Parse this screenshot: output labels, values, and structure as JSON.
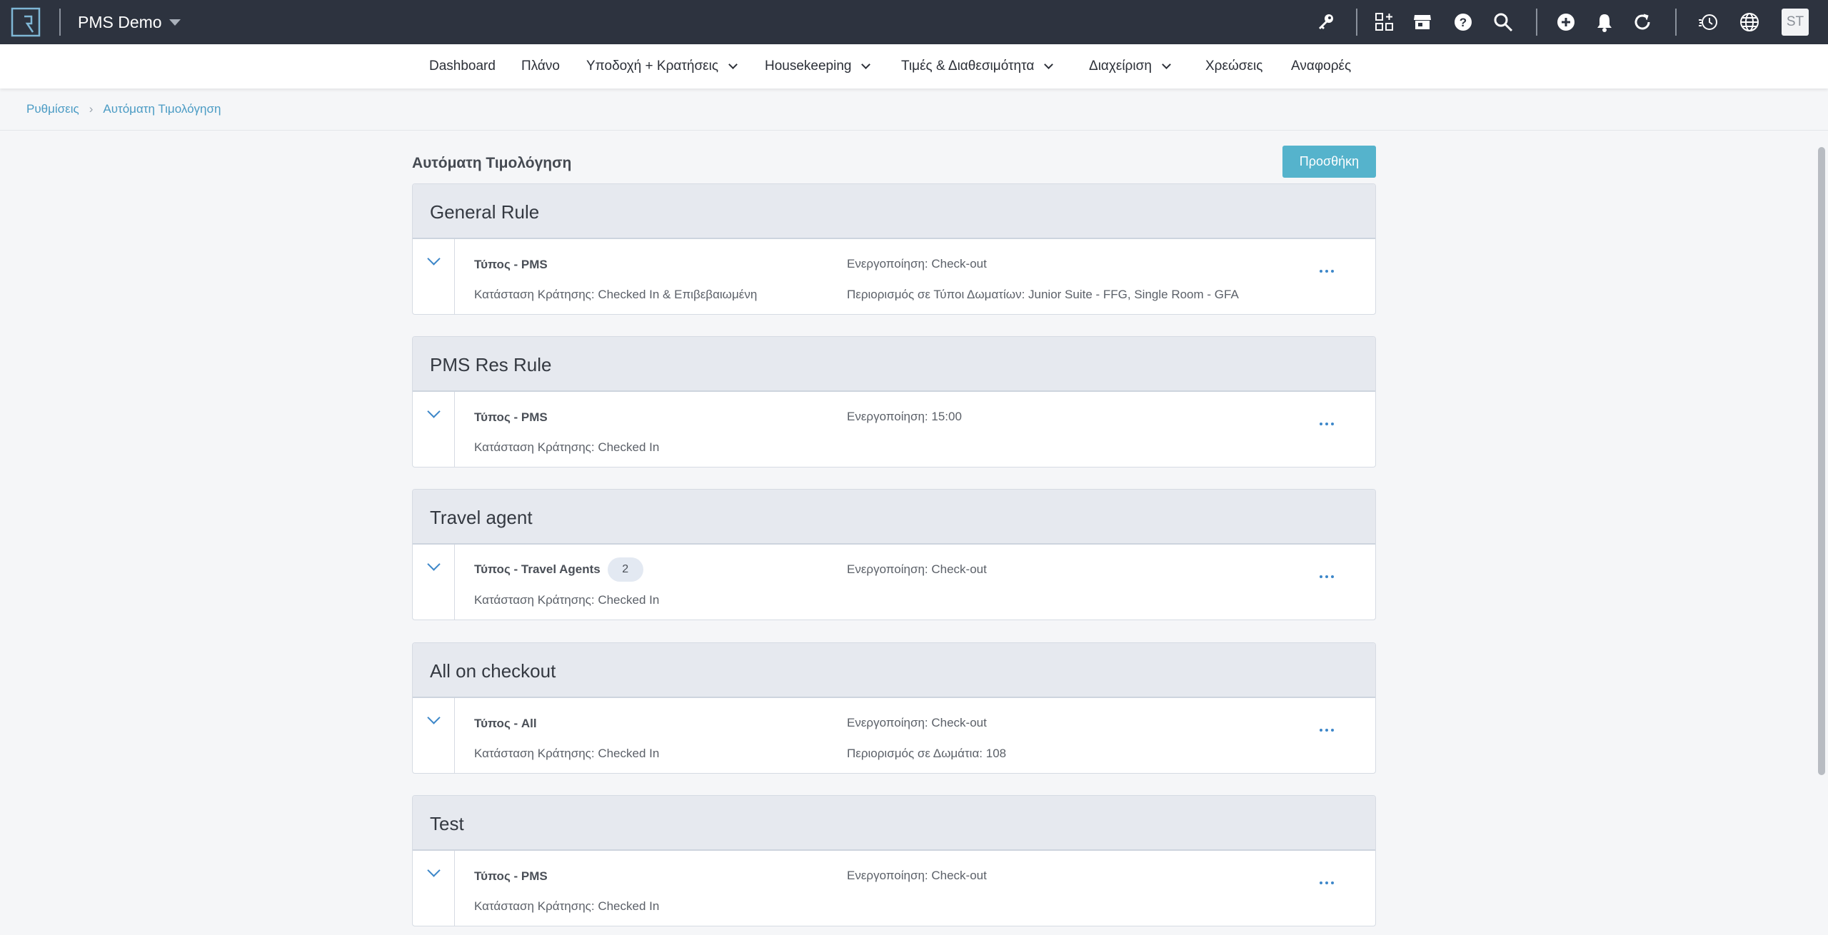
{
  "app": {
    "title": "PMS Demo",
    "avatar_initials": "ST",
    "icons": [
      "key-icon",
      "apps-add-icon",
      "store-icon",
      "help-icon",
      "search-icon",
      "add-circle-icon",
      "bell-icon",
      "refresh-icon",
      "history-clock-icon",
      "globe-icon"
    ]
  },
  "nav": {
    "items": [
      {
        "label": "Dashboard",
        "has_menu": false
      },
      {
        "label": "Πλάνο",
        "has_menu": false
      },
      {
        "label": "Υποδοχή + Κρατήσεις",
        "has_menu": true
      },
      {
        "label": "Housekeeping",
        "has_menu": true
      },
      {
        "label": "Τιμές & Διαθεσιμότητα",
        "has_menu": true
      },
      {
        "label": "Διαχείριση",
        "has_menu": true
      },
      {
        "label": "Χρεώσεις",
        "has_menu": false
      },
      {
        "label": "Αναφορές",
        "has_menu": false
      }
    ]
  },
  "breadcrumb": {
    "items": [
      "Ρυθμίσεις",
      "Αυτόματη Τιμολόγηση"
    ]
  },
  "page": {
    "title": "Αυτόματη Τιμολόγηση",
    "add_button": "Προσθήκη"
  },
  "rules": [
    {
      "name": "General Rule",
      "type": "Τύπος - PMS",
      "badge": "",
      "status": "Κατάσταση Κράτησης: Checked In & Επιβεβαιωμένη",
      "activation": "Ενεργοποίηση: Check-out",
      "restriction": "Περιορισμός σε Τύποι Δωματίων: Junior Suite - FFG, Single Room - GFA"
    },
    {
      "name": "PMS Res Rule",
      "type": "Τύπος - PMS",
      "badge": "",
      "status": "Κατάσταση Κράτησης: Checked In",
      "activation": "Ενεργοποίηση: 15:00",
      "restriction": ""
    },
    {
      "name": "Travel agent",
      "type": "Τύπος - Travel Agents",
      "badge": "2",
      "status": "Κατάσταση Κράτησης: Checked In",
      "activation": "Ενεργοποίηση: Check-out",
      "restriction": ""
    },
    {
      "name": "All on checkout",
      "type": "Τύπος - All",
      "badge": "",
      "status": "Κατάσταση Κράτησης: Checked In",
      "activation": "Ενεργοποίηση: Check-out",
      "restriction": "Περιορισμός σε Δωμάτια: 108"
    },
    {
      "name": "Test",
      "type": "Τύπος - PMS",
      "badge": "",
      "status": "Κατάσταση Κράτησης: Checked In",
      "activation": "Ενεργοποίηση: Check-out",
      "restriction": ""
    }
  ],
  "colors": {
    "topbar": "#2d333f",
    "accent": "#55b3cc",
    "link": "#4a9bc4",
    "rule_header": "#e6e9ef"
  }
}
